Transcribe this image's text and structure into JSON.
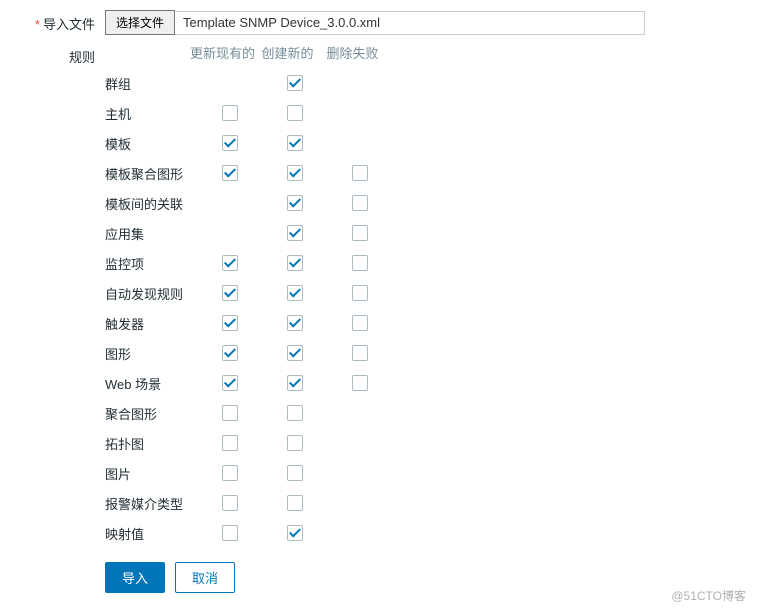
{
  "file": {
    "label": "导入文件",
    "button": "选择文件",
    "name": "Template SNMP Device_3.0.0.xml"
  },
  "rules": {
    "label": "规则",
    "headers": {
      "update": "更新现有的",
      "create": "创建新的",
      "delete": "删除失败"
    },
    "rows": [
      {
        "name": "群组",
        "cells": [
          null,
          true,
          null
        ]
      },
      {
        "name": "主机",
        "cells": [
          false,
          false,
          null
        ]
      },
      {
        "name": "模板",
        "cells": [
          true,
          true,
          null
        ]
      },
      {
        "name": "模板聚合图形",
        "cells": [
          true,
          true,
          false
        ]
      },
      {
        "name": "模板间的关联",
        "cells": [
          null,
          true,
          false
        ]
      },
      {
        "name": "应用集",
        "cells": [
          null,
          true,
          false
        ]
      },
      {
        "name": "监控项",
        "cells": [
          true,
          true,
          false
        ]
      },
      {
        "name": "自动发现规则",
        "cells": [
          true,
          true,
          false
        ]
      },
      {
        "name": "触发器",
        "cells": [
          true,
          true,
          false
        ]
      },
      {
        "name": "图形",
        "cells": [
          true,
          true,
          false
        ]
      },
      {
        "name": "Web 场景",
        "cells": [
          true,
          true,
          false
        ]
      },
      {
        "name": "聚合图形",
        "cells": [
          false,
          false,
          null
        ]
      },
      {
        "name": "拓扑图",
        "cells": [
          false,
          false,
          null
        ]
      },
      {
        "name": "图片",
        "cells": [
          false,
          false,
          null
        ]
      },
      {
        "name": "报警媒介类型",
        "cells": [
          false,
          false,
          null
        ]
      },
      {
        "name": "映射值",
        "cells": [
          false,
          true,
          null
        ]
      }
    ]
  },
  "buttons": {
    "import": "导入",
    "cancel": "取消"
  },
  "watermark": "@51CTO博客"
}
